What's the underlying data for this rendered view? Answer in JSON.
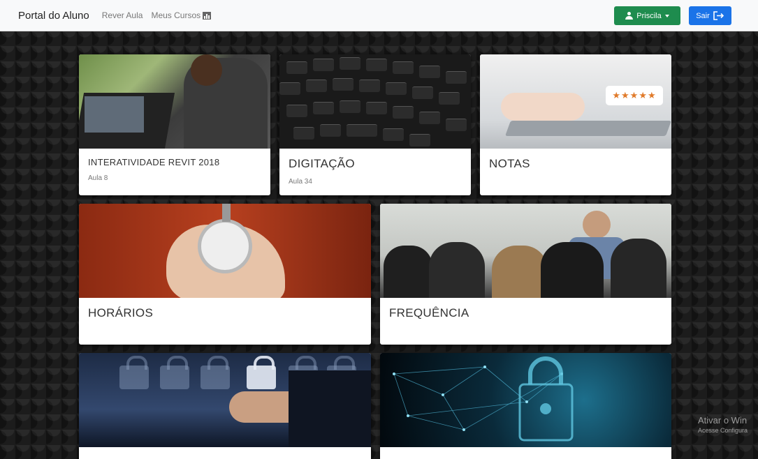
{
  "navbar": {
    "brand": "Portal do Aluno",
    "links": [
      "Rever Aula",
      "Meus Cursos"
    ],
    "meus_cursos_icon": "chart-icon",
    "user_button": "Priscila",
    "exit_button": "Sair",
    "colors": {
      "user_button": "#1e8c4e",
      "exit_button": "#1a73e8"
    }
  },
  "cards": [
    {
      "title": "INTERATIVIDADE REVIT 2018",
      "subtitle": "Aula 8",
      "image": "person-at-laptop"
    },
    {
      "title": "DIGITAÇÃO",
      "subtitle": "Aula 34",
      "image": "keyboard-closeup"
    },
    {
      "title": "NOTAS",
      "subtitle": "",
      "image": "typing-with-star-rating"
    },
    {
      "title": "HORÁRIOS",
      "subtitle": "",
      "image": "stopwatch-in-hand"
    },
    {
      "title": "FREQUÊNCIA",
      "subtitle": "",
      "image": "classroom"
    },
    {
      "title": "",
      "subtitle": "",
      "image": "hand-touching-locks"
    },
    {
      "title": "",
      "subtitle": "",
      "image": "digital-network-lock"
    }
  ],
  "watermark": {
    "line1": "Ativar o Win",
    "line2": "Acesse Configura"
  }
}
